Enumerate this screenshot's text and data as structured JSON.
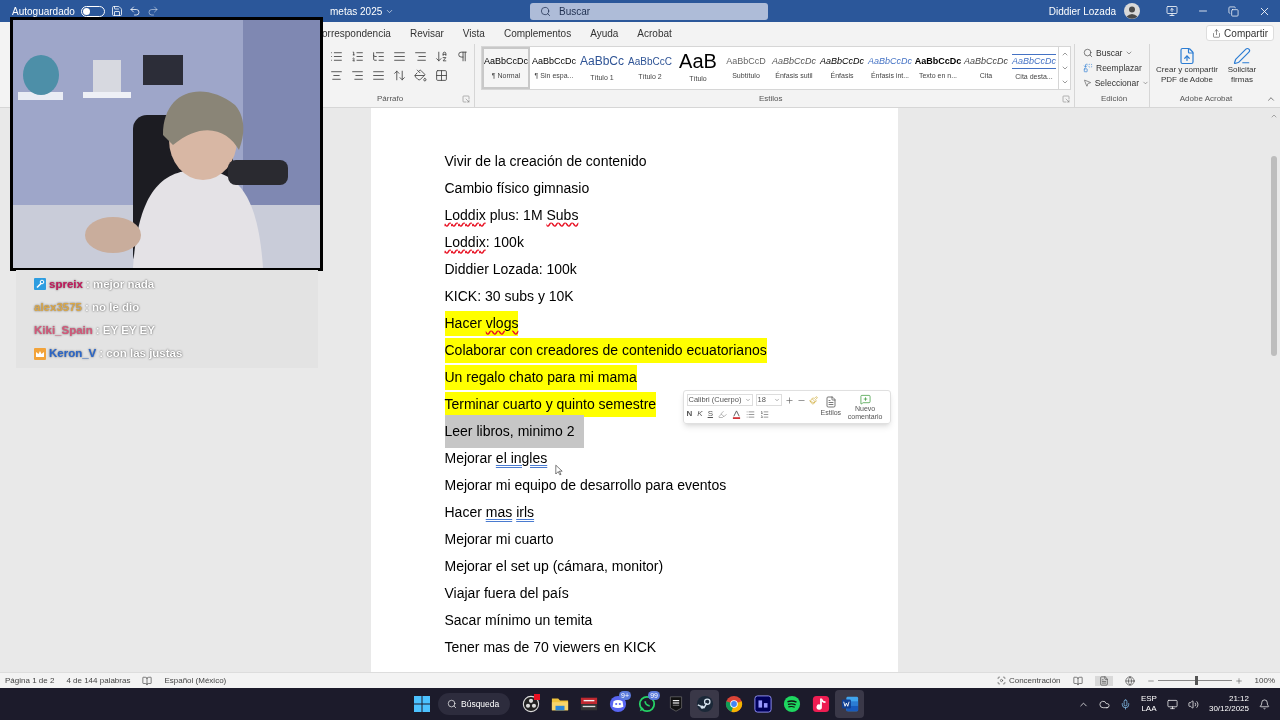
{
  "title_bar": {
    "autosave_label": "Autoguardado",
    "autosave_on": false,
    "document_title": "metas 2025",
    "search_placeholder": "Buscar",
    "user_name": "Diddier Lozada"
  },
  "ribbon_tabs": [
    {
      "label": "orrespondencia",
      "selected": false
    },
    {
      "label": "Revisar",
      "selected": false
    },
    {
      "label": "Vista",
      "selected": false
    },
    {
      "label": "Complementos",
      "selected": false
    },
    {
      "label": "Ayuda",
      "selected": false
    },
    {
      "label": "Acrobat",
      "selected": false
    }
  ],
  "share_button": "Compartir",
  "ribbon": {
    "paragraph_label": "Párrafo",
    "styles_label": "Estilos",
    "styles": [
      {
        "preview": "AaBbCcDc",
        "label": "¶ Normal",
        "kind": "normal",
        "selected": true
      },
      {
        "preview": "AaBbCcDc",
        "label": "¶ Sin espa...",
        "kind": "no-spacing",
        "selected": false
      },
      {
        "preview": "AaBbCc",
        "label": "Título 1",
        "kind": "heading1",
        "selected": false
      },
      {
        "preview": "AaBbCcC",
        "label": "Título 2",
        "kind": "heading2",
        "selected": false
      },
      {
        "preview": "AaB",
        "label": "Título",
        "kind": "title",
        "selected": false
      },
      {
        "preview": "AaBbCcD",
        "label": "Subtítulo",
        "kind": "subtitle",
        "selected": false
      },
      {
        "preview": "AaBbCcDc",
        "label": "Énfasis sutil",
        "kind": "subtle-emphasis",
        "selected": false
      },
      {
        "preview": "AaBbCcDc",
        "label": "Énfasis",
        "kind": "emphasis",
        "selected": false
      },
      {
        "preview": "AaBbCcDc",
        "label": "Énfasis int...",
        "kind": "intense-emphasis",
        "selected": false
      },
      {
        "preview": "AaBbCcDc",
        "label": "Texto en n...",
        "kind": "strong",
        "selected": false
      },
      {
        "preview": "AaBbCcDc",
        "label": "Cita",
        "kind": "quote",
        "selected": false
      },
      {
        "preview": "AaBbCcDc",
        "label": "Cita desta...",
        "kind": "intense-quote",
        "selected": false
      }
    ],
    "editing": {
      "label": "Edición",
      "find": "Buscar",
      "replace": "Reemplazar",
      "select": "Seleccionar"
    },
    "acrobat": {
      "label": "Adobe Acrobat",
      "create_pdf": "Crear y compartir PDF de Adobe",
      "request_signatures": "Solicitar firmas"
    }
  },
  "stream_chat": [
    {
      "user": "spreix",
      "color": "#c2185b",
      "message": ": mejor nada",
      "kind": "wrench"
    },
    {
      "user": "alex3575",
      "color": "#d9a74a",
      "message": ": no le dio",
      "kind": "plain"
    },
    {
      "user": "Kiki_Spain",
      "color": "#d4587a",
      "message": ": EY EY EY",
      "kind": "plain"
    },
    {
      "user": "Keron_V",
      "color": "#2a66c9",
      "message": ": con las justas",
      "kind": "crown"
    }
  ],
  "document": {
    "lines": [
      {
        "segments": [
          {
            "text": "Vivir de la creación de contenido"
          }
        ],
        "highlight": false,
        "selected": false
      },
      {
        "segments": [
          {
            "text": "Cambio físico gimnasio"
          }
        ],
        "highlight": false,
        "selected": false
      },
      {
        "segments": [
          {
            "text": "Loddix",
            "kind": "spelling-error"
          },
          {
            "text": " plus: 1M "
          },
          {
            "text": "Subs",
            "kind": "spelling-error"
          }
        ],
        "highlight": false,
        "selected": false
      },
      {
        "segments": [
          {
            "text": "Loddix",
            "kind": "spelling-error"
          },
          {
            "text": ": 100k"
          }
        ],
        "highlight": false,
        "selected": false
      },
      {
        "segments": [
          {
            "text": "Diddier Lozada: 100k"
          }
        ],
        "highlight": false,
        "selected": false
      },
      {
        "segments": [
          {
            "text": "KICK: 30 subs y 10K"
          }
        ],
        "highlight": false,
        "selected": false
      },
      {
        "segments": [
          {
            "text": "Hacer "
          },
          {
            "text": "vlogs",
            "kind": "spelling-error"
          }
        ],
        "highlight": true,
        "selected": false
      },
      {
        "segments": [
          {
            "text": "Colaborar con creadores de contenido ecuatorianos"
          }
        ],
        "highlight": true,
        "selected": false
      },
      {
        "segments": [
          {
            "text": "Un regalo chato para mi mama"
          }
        ],
        "highlight": true,
        "selected": false
      },
      {
        "segments": [
          {
            "text": "Terminar cuarto y quinto semestre"
          }
        ],
        "highlight": true,
        "selected": false
      },
      {
        "segments": [
          {
            "text": "Leer libros, minimo 2"
          }
        ],
        "highlight": false,
        "selected": true
      },
      {
        "segments": [
          {
            "text": "Mejorar "
          },
          {
            "text": "el ingles",
            "kind": "grammar-error"
          }
        ],
        "highlight": false,
        "selected": false
      },
      {
        "segments": [
          {
            "text": "Mejorar mi equipo de desarrollo para eventos"
          }
        ],
        "highlight": false,
        "selected": false
      },
      {
        "segments": [
          {
            "text": "Hacer "
          },
          {
            "text": "mas",
            "kind": "grammar-error"
          },
          {
            "text": "irls",
            "kind": "grammar-error-spaced"
          }
        ],
        "highlight": false,
        "selected": false
      },
      {
        "segments": [
          {
            "text": "Mejorar mi cuarto"
          }
        ],
        "highlight": false,
        "selected": false
      },
      {
        "segments": [
          {
            "text": "Mejorar el set up (cámara, monitor)"
          }
        ],
        "highlight": false,
        "selected": false
      },
      {
        "segments": [
          {
            "text": "Viajar fuera del país"
          }
        ],
        "highlight": false,
        "selected": false
      },
      {
        "segments": [
          {
            "text": "Sacar mínimo un temita"
          }
        ],
        "highlight": false,
        "selected": false
      },
      {
        "segments": [
          {
            "text": "Tener mas de 70 viewers en KICK"
          }
        ],
        "highlight": false,
        "selected": false
      }
    ]
  },
  "mini_toolbar": {
    "font": "Calibri (Cuerpo)",
    "size": "18",
    "bold": "N",
    "italic": "K",
    "strike": "S",
    "styles_label": "Estilos",
    "comment_label": "Nuevo comentario"
  },
  "status_bar": {
    "page": "Página 1 de 2",
    "words": "4 de 144 palabras",
    "language": "Español (México)",
    "focus": "Concentración",
    "zoom": "100%",
    "zoom_slider": {
      "level": 0.5
    }
  },
  "taskbar": {
    "search": "Búsqueda",
    "apps": [
      {
        "kind": "recorder",
        "active": false,
        "alert": true
      },
      {
        "kind": "folder",
        "active": false
      },
      {
        "kind": "mixer",
        "active": false
      },
      {
        "kind": "chat",
        "active": false,
        "badge": "9+"
      },
      {
        "kind": "messenger",
        "active": false,
        "badge": "99"
      },
      {
        "kind": "store",
        "active": false
      },
      {
        "kind": "launcher",
        "active": true
      },
      {
        "kind": "browser",
        "active": false
      },
      {
        "kind": "video-editor",
        "active": false
      },
      {
        "kind": "music",
        "active": false
      },
      {
        "kind": "short-video",
        "active": false
      },
      {
        "kind": "word",
        "active": true
      }
    ],
    "language_top": "ESP",
    "language_bottom": "LAA",
    "time": "21:12",
    "date": "30/12/2025"
  }
}
